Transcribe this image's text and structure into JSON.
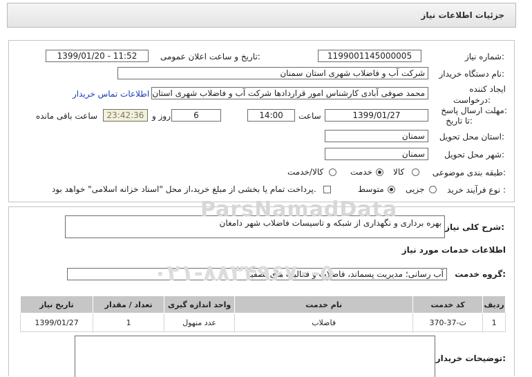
{
  "page_title": "جزئیات اطلاعات نیاز",
  "fields": {
    "need_number_label": "شماره نیاز:",
    "need_number": "1199001145000005",
    "announce_label": "تاریخ و ساعت اعلان عمومی:",
    "announce_value": "1399/01/20 - 11:52",
    "buyer_org_label": "نام دستگاه خریدار:",
    "buyer_org": "شرکت آب و فاضلاب شهری استان سمنان",
    "creator_label_1": "ایجاد کننده",
    "creator_label_2": "درخواست:",
    "creator": "محمد صوفی آبادی کارشناس امور قراردادها شرکت آب و فاضلاب شهری استان",
    "contact_link": "اطلاعات تماس خریدار",
    "deadline_label_1": "مهلت ارسال پاسخ:",
    "deadline_label_2": "تا تاریخ:",
    "deadline_date": "1399/01/27",
    "time_label": "ساعت",
    "deadline_time": "14:00",
    "days_value": "6",
    "days_label": "روز و",
    "remaining_time": "23:42:36",
    "remaining_label": "ساعت باقی مانده",
    "province_label": "استان محل تحویل:",
    "province": "سمنان",
    "city_label": "شهر محل تحویل:",
    "city": "سمنان",
    "category_label": "طبقه بندی موضوعی:",
    "category_options": [
      "کالا",
      "خدمت",
      "کالا/خدمت"
    ],
    "category_selected": "خدمت",
    "process_label": "نوع فرآیند خرید :",
    "process_options": [
      "جزیی",
      "متوسط"
    ],
    "process_selected": "متوسط",
    "payment_note": "پرداخت تمام یا بخشی از مبلغ خرید،از محل \"اسناد خزانه اسلامی\" خواهد بود."
  },
  "description": {
    "label": "شرح کلی نیاز:",
    "value": "بهره برداری و نگهداری از شبکه و تاسیسات فاضلاب شهر دامغان"
  },
  "services": {
    "section_title": "اطلاعات خدمات مورد نیاز",
    "group_label": "گروه خدمت:",
    "group_value": "آب رسانی؛ مدیریت پسماند، فاضلاب و فعالیت های تصفیه",
    "columns": [
      "ردیف",
      "کد خدمت",
      "نام خدمت",
      "واحد اندازه گیری",
      "تعداد / مقدار",
      "تاریخ نیاز"
    ],
    "rows": [
      [
        "1",
        "ث-37-370",
        "فاضلاب",
        "عدد منهول",
        "1",
        "1399/01/27"
      ]
    ]
  },
  "buyer_notes": {
    "label": "توضیحات خریدار:",
    "value": ""
  },
  "watermark": {
    "line1": "ParsNamadData",
    "line2": "۰۲۱-۸۸۳۴۹۶۷۰-۵"
  }
}
